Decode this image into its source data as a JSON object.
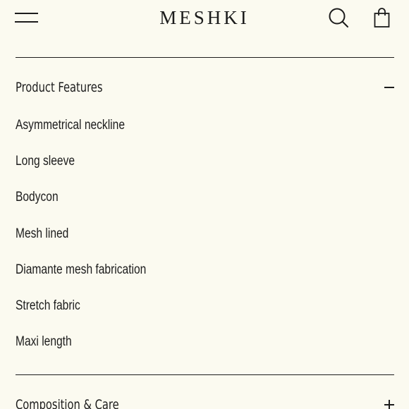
{
  "header": {
    "logo": "MESHKI",
    "menu_icon": "hamburger-menu-icon",
    "search_icon": "search-icon",
    "bag_icon": "shopping-bag-icon"
  },
  "sections": [
    {
      "title": "Product Features",
      "expanded": true,
      "toggle_icon": "minus-icon",
      "items": [
        "Asymmetrical neckline",
        "Long sleeve",
        "Bodycon",
        "Mesh lined",
        "Diamante mesh fabrication",
        "Stretch fabric",
        "Maxi length"
      ]
    },
    {
      "title": "Composition & Care",
      "expanded": false,
      "toggle_icon": "plus-icon"
    }
  ],
  "colors": {
    "background": "#fbfaf0",
    "text": "#1c1c1c"
  }
}
